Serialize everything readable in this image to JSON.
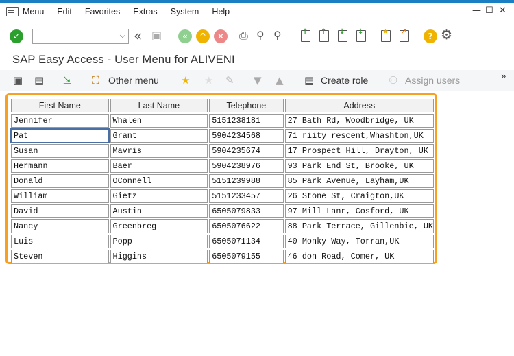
{
  "menubar": {
    "items": [
      "Menu",
      "Edit",
      "Favorites",
      "Extras",
      "System",
      "Help"
    ]
  },
  "window": {
    "minimize": "—",
    "maximize": "☐",
    "close": "✕"
  },
  "toolbar": {
    "command_field_value": "",
    "command_field_dropdown": "⌵"
  },
  "title": "SAP Easy Access  -  User Menu for ALIVENI",
  "app_toolbar": {
    "other_menu": "Other menu",
    "create_role": "Create role",
    "assign_users": "Assign users",
    "more": "»"
  },
  "table": {
    "headers": [
      "First Name",
      "Last Name",
      "Telephone",
      "Address"
    ],
    "rows": [
      [
        "Jennifer",
        "Whalen",
        "5151238181",
        "27 Bath Rd, Woodbridge, UK"
      ],
      [
        "Pat",
        "Grant",
        "5904234568",
        "71 riity rescent,Whashton,UK"
      ],
      [
        "Susan",
        "Mavris",
        "5904235674",
        "17 Prospect Hill, Drayton, UK"
      ],
      [
        "Hermann",
        "Baer",
        "5904238976",
        "93 Park End St, Brooke, UK"
      ],
      [
        "Donald",
        "OConnell",
        "5151239988",
        "85 Park Avenue, Layham,UK"
      ],
      [
        "William",
        "Gietz",
        "5151233457",
        "26 Stone St, Craigton,UK"
      ],
      [
        "David",
        "Austin",
        "6505079833",
        "97 Mill Lanr, Cosford, UK"
      ],
      [
        "Nancy",
        "Greenbreg",
        "6505076622",
        "88 Park Terrace, Gillenbie, UK"
      ],
      [
        "Luis",
        "Popp",
        "6505071134",
        "40 Monky Way, Torran,UK"
      ],
      [
        "Steven",
        "Higgins",
        "6505079155",
        "46 don Road, Comer, UK"
      ]
    ]
  },
  "colors": {
    "accent_blue": "#1b7fc4",
    "highlight_orange": "#f7a023",
    "ok_green": "#2ca02c",
    "nav_yellow": "#f0b400",
    "cancel_red": "#e05050"
  }
}
